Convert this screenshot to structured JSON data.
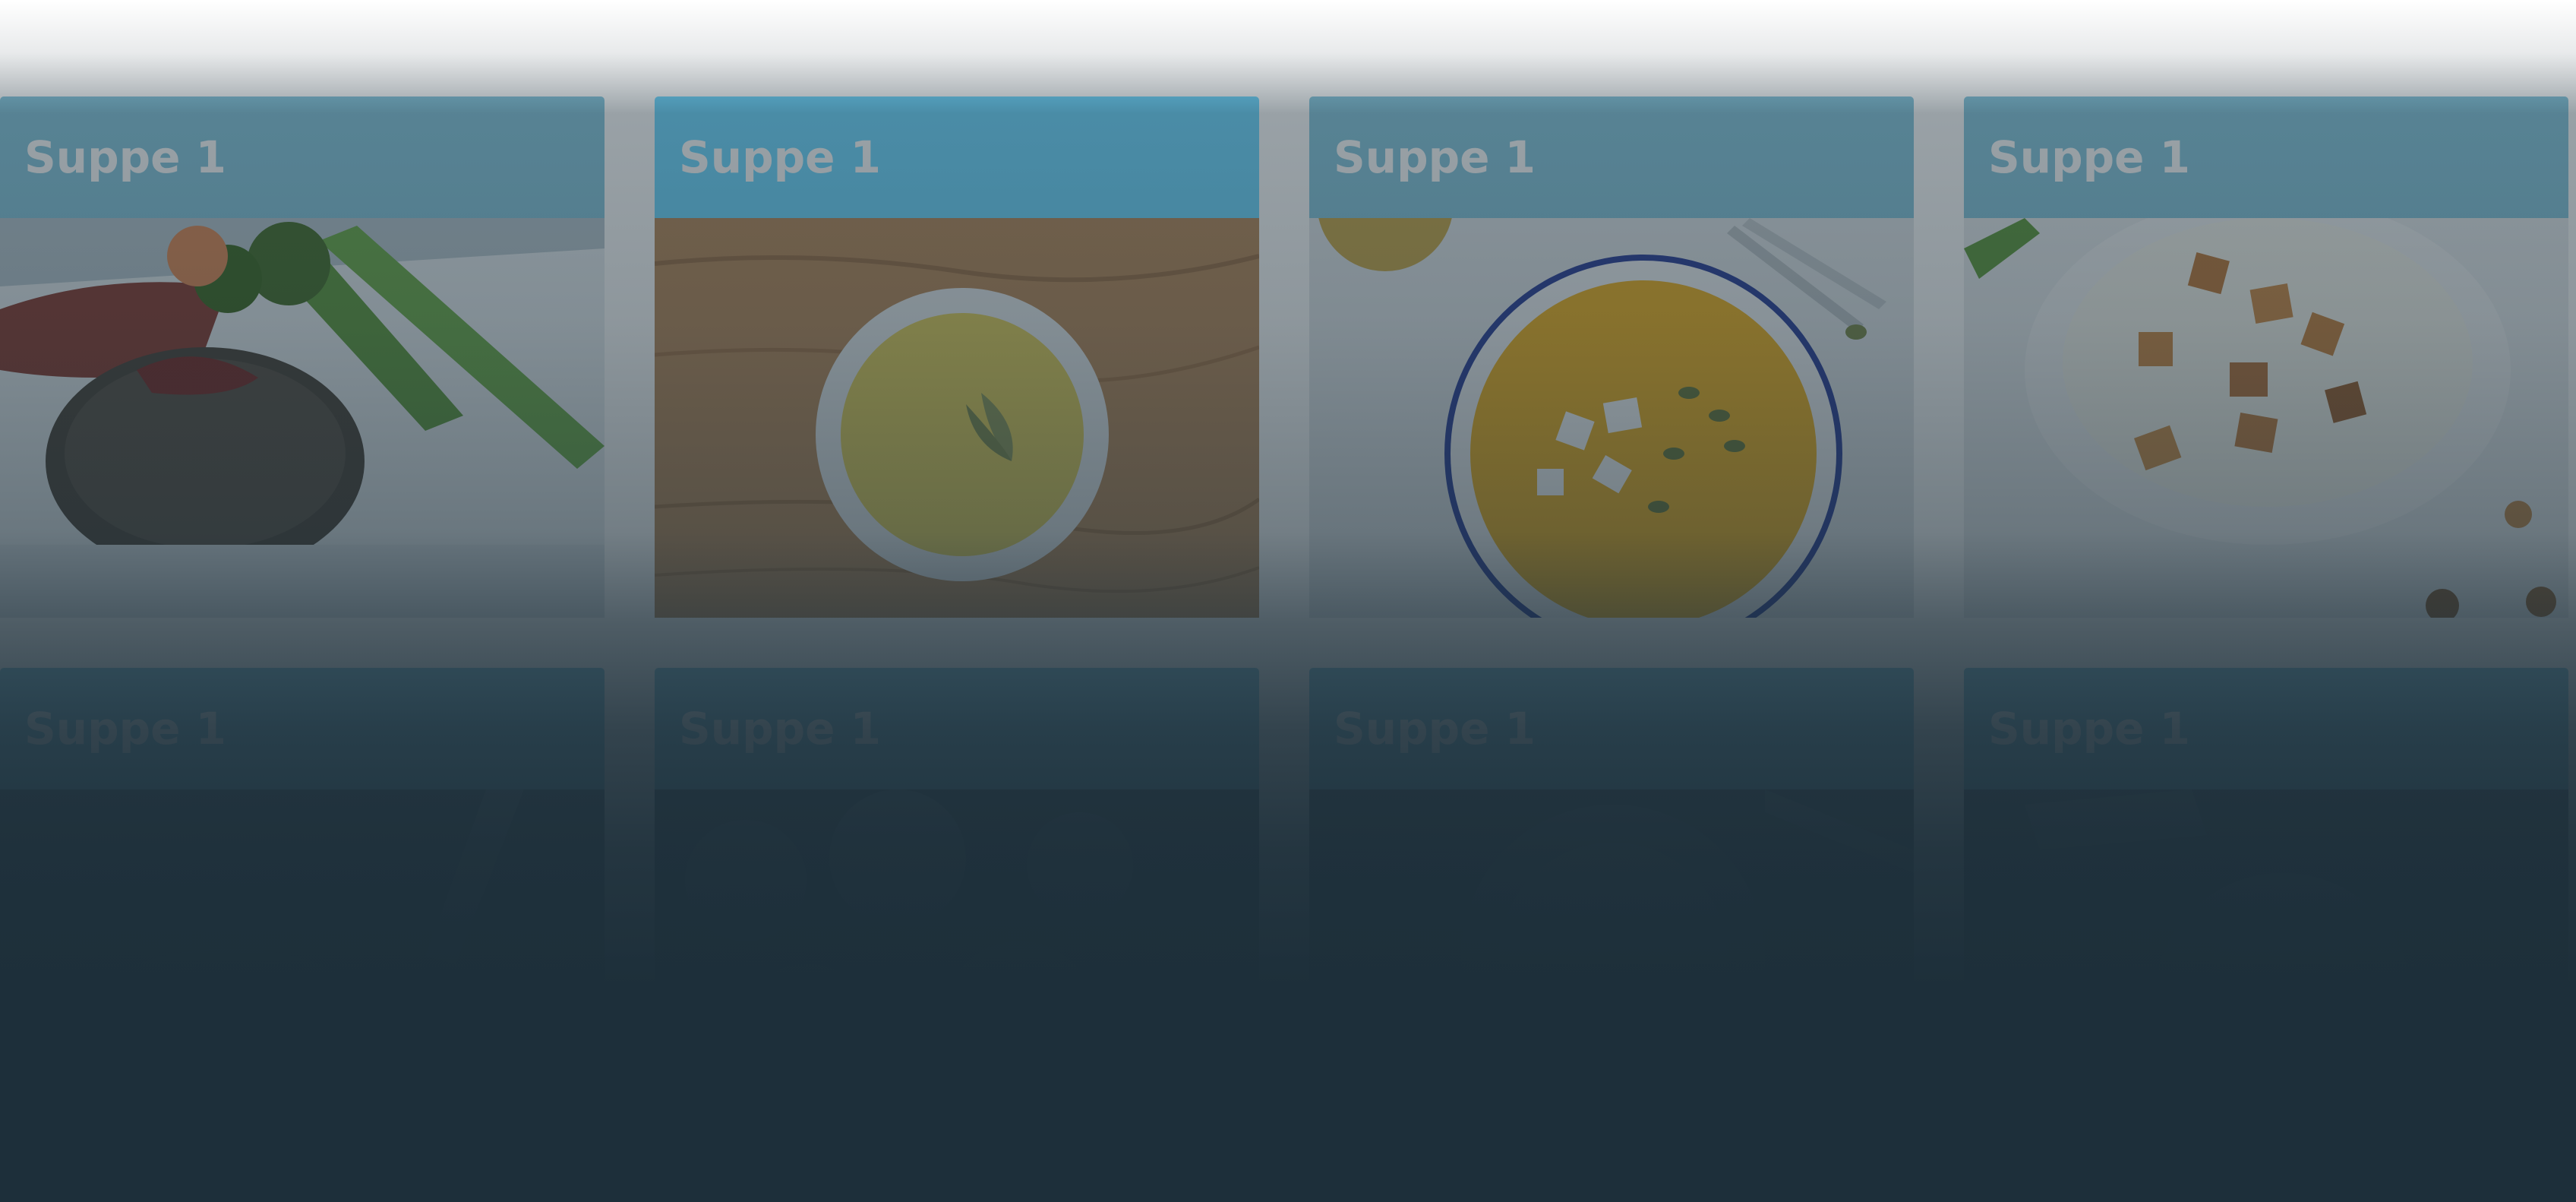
{
  "cards": [
    {
      "title": "Suppe 1",
      "image": "steak-with-broccoli-photo",
      "active": false
    },
    {
      "title": "Suppe 1",
      "image": "soup-bowl-on-wood-photo",
      "active": true
    },
    {
      "title": "Suppe 1",
      "image": "pumpkin-soup-with-seeds-photo",
      "active": false
    },
    {
      "title": "Suppe 1",
      "image": "cream-soup-with-croutons-photo",
      "active": false
    },
    {
      "title": "Suppe 1",
      "image": "dark-food-photo",
      "active": false
    },
    {
      "title": "Suppe 1",
      "image": "dark-food-photo",
      "active": false
    },
    {
      "title": "Suppe 1",
      "image": "dark-food-photo",
      "active": false
    },
    {
      "title": "Suppe 1",
      "image": "dark-food-photo",
      "active": false
    }
  ],
  "colors": {
    "header": "#87c7dd",
    "header_active": "#6fd8ff",
    "overlay": "#1d2f3a"
  }
}
